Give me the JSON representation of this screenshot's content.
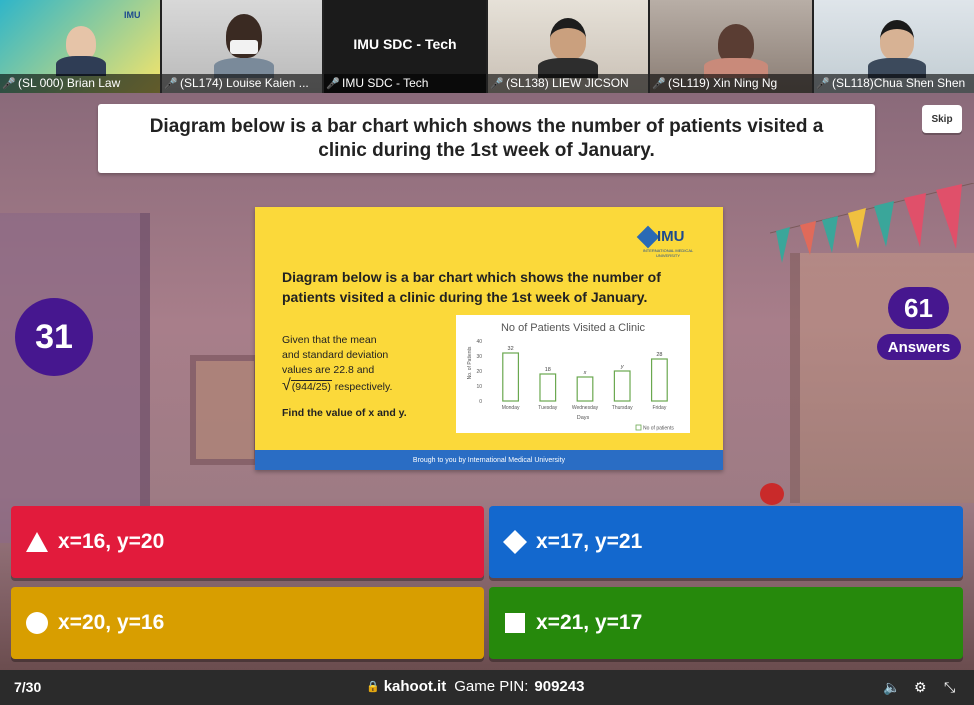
{
  "video_participants": [
    {
      "name": "(SL 000) Brian Law",
      "mic_muted": false,
      "logo_text": "IMU"
    },
    {
      "name": "(SL174) Louise Kaien ...",
      "mic_muted": true
    },
    {
      "name": "IMU SDC - Tech",
      "mic_muted": true,
      "display_label": "IMU SDC - Tech"
    },
    {
      "name": "(SL138) LIEW JICSON",
      "mic_muted": true
    },
    {
      "name": "(SL119) Xin Ning Ng",
      "mic_muted": true
    },
    {
      "name": "(SL118)Chua Shen Shen",
      "mic_muted": true
    }
  ],
  "question": {
    "text": "Diagram below is a bar chart which shows the number of patients visited a clinic during the 1st week of January.",
    "skip_label": "Skip"
  },
  "timer": "31",
  "answers": {
    "count": "61",
    "label": "Answers"
  },
  "slide": {
    "logo": "IMU",
    "logo_sub": "INTERNATIONAL MEDICAL UNIVERSITY",
    "title": "Diagram below is a bar chart which shows the number of patients visited a clinic during the 1st week of January.",
    "given_line1": "Given that the mean",
    "given_line2": "and standard deviation",
    "given_line3": "values are 22.8 and",
    "given_sqrt": "(944/25)",
    "given_tail": " respectively.",
    "find": "Find the value of x and y.",
    "footer": "Brough to you by International Medical University"
  },
  "chart_data": {
    "type": "bar",
    "title": "No of Patients Visited a Clinic",
    "categories": [
      "Monday",
      "Tuesday",
      "Wednesday",
      "Thursday",
      "Friday"
    ],
    "values": [
      32,
      18,
      16,
      20,
      28
    ],
    "data_labels": [
      "32",
      "18",
      "x",
      "y",
      "28"
    ],
    "xlabel": "Days",
    "ylabel": "No. of Patients",
    "ylim": [
      0,
      40
    ],
    "yticks": [
      "0",
      "10",
      "20",
      "30",
      "40"
    ],
    "legend": "No of patients",
    "legend_position": "bottom-right",
    "bar_color": "#6aa84f"
  },
  "options": [
    {
      "shape": "triangle",
      "text": "x=16, y=20",
      "color": "#e21b3c"
    },
    {
      "shape": "diamond",
      "text": "x=17, y=21",
      "color": "#1368ce"
    },
    {
      "shape": "circle",
      "text": "x=20, y=16",
      "color": "#d89e00"
    },
    {
      "shape": "square",
      "text": "x=21, y=17",
      "color": "#26890c"
    }
  ],
  "footer": {
    "counter": "7/30",
    "site": "kahoot.it",
    "pin_label": "Game PIN:",
    "pin": "909243"
  }
}
